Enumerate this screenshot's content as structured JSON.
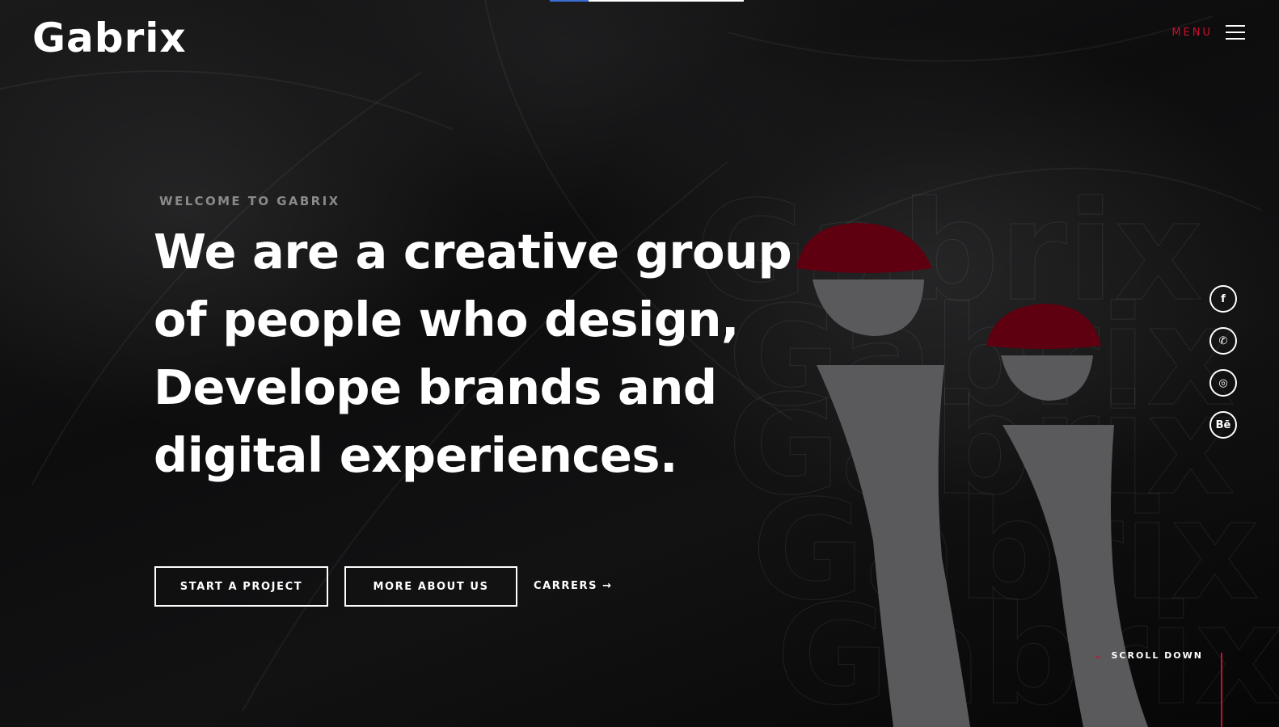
{
  "brand": {
    "logo_text": "Gabrix"
  },
  "header": {
    "menu_label": "MENU"
  },
  "progress": {
    "fraction": 0.2
  },
  "hero": {
    "eyebrow": "WELCOME TO GABRIX",
    "headline_lines": [
      "We are a creative group",
      "of people who design,",
      "Develope brands and",
      "digital experiences."
    ]
  },
  "actions": {
    "start_project": "START A PROJECT",
    "more_about": "MORE ABOUT US",
    "careers": "CARRERS",
    "careers_arrow": "→"
  },
  "social": [
    {
      "icon": "facebook-icon",
      "glyph": "f"
    },
    {
      "icon": "whatsapp-icon",
      "glyph": "✆"
    },
    {
      "icon": "instagram-icon",
      "glyph": "◎"
    },
    {
      "icon": "behance-icon",
      "glyph": "Bē"
    }
  ],
  "scroll": {
    "label": "SCROLL DOWN",
    "chevron": "⌄"
  },
  "colors": {
    "accent": "#c8102e",
    "background": "#0b0b0c",
    "figure_grey": "#5a5a5c",
    "hat_red": "#5e0010"
  }
}
